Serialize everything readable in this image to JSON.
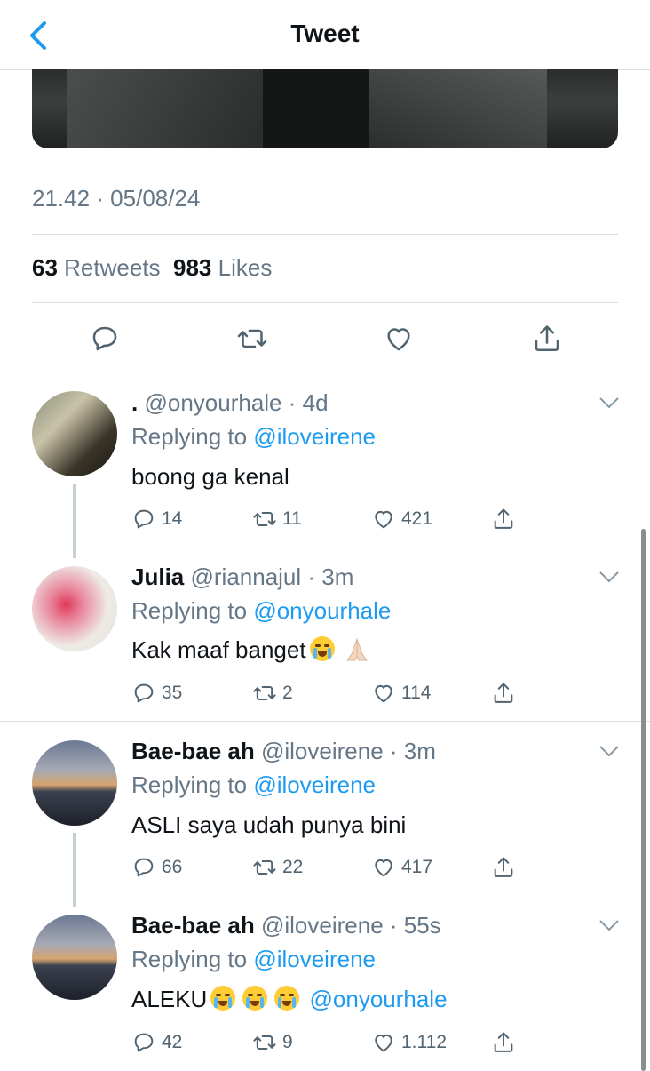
{
  "header": {
    "title": "Tweet"
  },
  "tweet": {
    "timestamp": "21.42 · 05/08/24",
    "retweets_count": "63",
    "retweets_label": "Retweets",
    "likes_count": "983",
    "likes_label": "Likes"
  },
  "replies": [
    {
      "name": ".",
      "handle": "@onyourhale",
      "time": "4d",
      "replying_prefix": "Replying to",
      "replying_to": "@iloveirene",
      "text": "boong ga kenal",
      "replies": "14",
      "retweets": "11",
      "likes": "421"
    },
    {
      "name": "Julia",
      "handle": "@riannajul",
      "time": "3m",
      "replying_prefix": "Replying to",
      "replying_to": "@onyourhale",
      "text": "Kak maaf banget",
      "replies": "35",
      "retweets": "2",
      "likes": "114"
    },
    {
      "name": "Bae-bae ah",
      "handle": "@iloveirene",
      "time": "3m",
      "replying_prefix": "Replying to",
      "replying_to": "@iloveirene",
      "text": "ASLI saya udah punya bini",
      "replies": "66",
      "retweets": "22",
      "likes": "417"
    },
    {
      "name": "Bae-bae ah",
      "handle": "@iloveirene",
      "time": "55s",
      "replying_prefix": "Replying to",
      "replying_to": "@iloveirene",
      "text": "ALEKU",
      "mention": "@onyourhale",
      "replies": "42",
      "retweets": "9",
      "likes": "1.112"
    }
  ],
  "colors": {
    "accent": "#1d9bf0",
    "secondary_text": "#657786",
    "separator": "#dbdfe3"
  },
  "icons": [
    "back-chevron-icon",
    "reply-icon",
    "retweet-icon",
    "like-icon",
    "share-icon",
    "chevron-down-icon",
    "loudly-crying-emoji",
    "folded-hands-emoji"
  ]
}
